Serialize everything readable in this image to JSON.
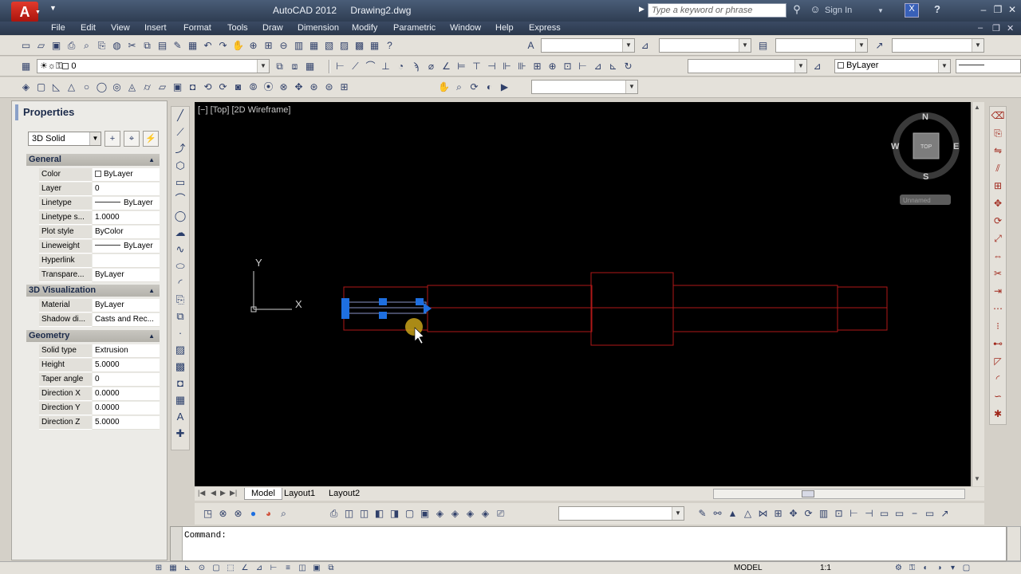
{
  "window": {
    "app_name": "AutoCAD 2012",
    "file_name": "Drawing2.dwg",
    "search_placeholder": "Type a keyword or phrase",
    "sign_in_label": "Sign In"
  },
  "menu": [
    "File",
    "Edit",
    "View",
    "Insert",
    "Format",
    "Tools",
    "Draw",
    "Dimension",
    "Modify",
    "Parametric",
    "Window",
    "Help",
    "Express"
  ],
  "toolbars": {
    "layer_value": "0",
    "color_value": "ByLayer"
  },
  "properties": {
    "title": "Properties",
    "object_type": "3D Solid",
    "categories": [
      {
        "name": "General",
        "rows": [
          {
            "name": "Color",
            "value": "ByLayer"
          },
          {
            "name": "Layer",
            "value": "0"
          },
          {
            "name": "Linetype",
            "value": "ByLayer"
          },
          {
            "name": "Linetype s...",
            "value": "1.0000"
          },
          {
            "name": "Plot style",
            "value": "ByColor"
          },
          {
            "name": "Lineweight",
            "value": "ByLayer"
          },
          {
            "name": "Hyperlink",
            "value": ""
          },
          {
            "name": "Transpare...",
            "value": "ByLayer"
          }
        ]
      },
      {
        "name": "3D Visualization",
        "rows": [
          {
            "name": "Material",
            "value": "ByLayer"
          },
          {
            "name": "Shadow di...",
            "value": "Casts and Rec..."
          }
        ]
      },
      {
        "name": "Geometry",
        "rows": [
          {
            "name": "Solid type",
            "value": "Extrusion"
          },
          {
            "name": "Height",
            "value": "5.0000"
          },
          {
            "name": "Taper angle",
            "value": "0"
          },
          {
            "name": "Direction X",
            "value": "0.0000"
          },
          {
            "name": "Direction Y",
            "value": "0.0000"
          },
          {
            "name": "Direction Z",
            "value": "5.0000"
          }
        ]
      }
    ]
  },
  "viewport": {
    "label": "[−] [Top] [2D Wireframe]",
    "ucs_x": "X",
    "ucs_y": "Y",
    "viewcube": {
      "north": "N",
      "south": "S",
      "east": "E",
      "west": "W",
      "face": "TOP",
      "wcs": "Unnamed"
    },
    "line_color": "#b01818",
    "grip_color": "#1e6fe0"
  },
  "layout_tabs": [
    "Model",
    "Layout1",
    "Layout2"
  ],
  "command": {
    "prompt": "Command:"
  },
  "status": {
    "coords": "",
    "model_label": "MODEL",
    "scale_label": "1:1"
  }
}
